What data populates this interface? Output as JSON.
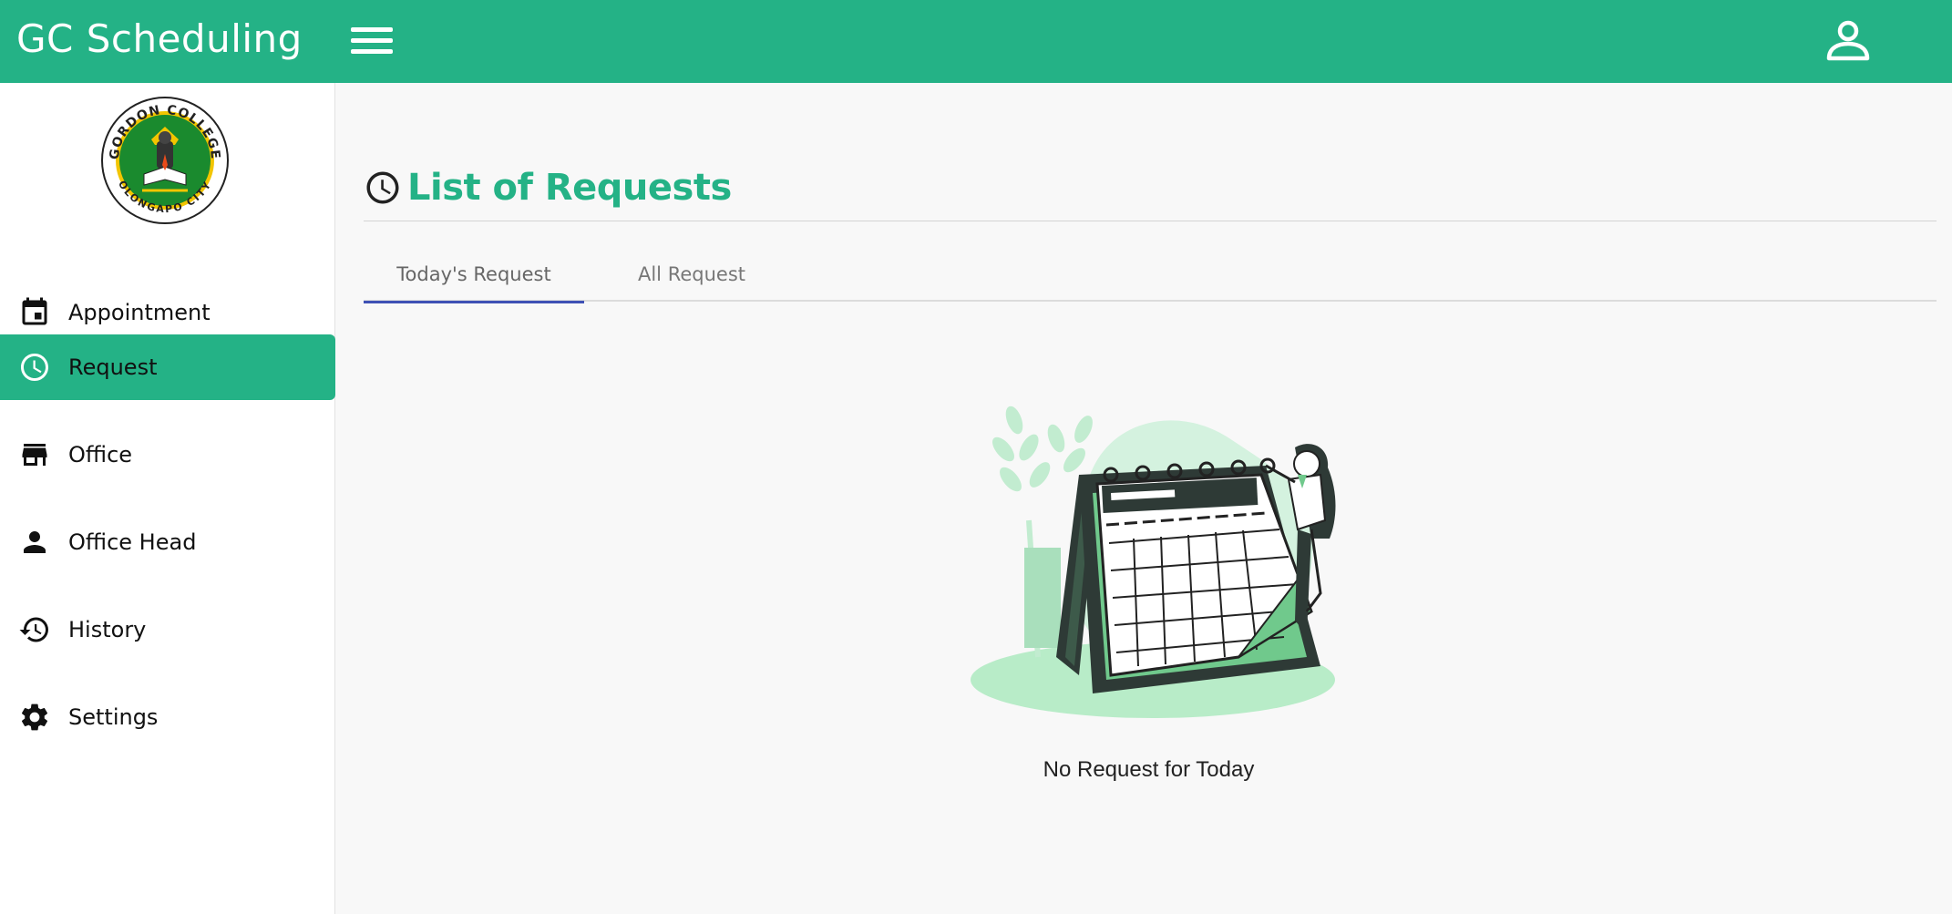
{
  "app": {
    "title": "GC Scheduling"
  },
  "header": {
    "menu_icon": "hamburger-icon",
    "account_icon": "person-outline-icon"
  },
  "sidebar": {
    "logo": {
      "top_text": "GORDON COLLEGE",
      "bottom_text": "OLONGAPO CITY",
      "colors": [
        "#1a8a2e",
        "#f2c500",
        "#222222"
      ]
    },
    "items": [
      {
        "label": "Appointment",
        "icon": "calendar-icon",
        "active": false
      },
      {
        "label": "Request",
        "icon": "clock-icon",
        "active": true
      },
      {
        "label": "Office",
        "icon": "store-icon",
        "active": false
      },
      {
        "label": "Office Head",
        "icon": "person-icon",
        "active": false
      },
      {
        "label": "History",
        "icon": "history-icon",
        "active": false
      },
      {
        "label": "Settings",
        "icon": "gear-icon",
        "active": false
      }
    ]
  },
  "main": {
    "title": "List of Requests",
    "title_icon": "clock-icon",
    "tabs": [
      {
        "label": "Today's Request",
        "active": true
      },
      {
        "label": "All Request",
        "active": false
      }
    ],
    "empty_state": {
      "message": "No Request for Today",
      "illustration": "calendar-illustration"
    }
  },
  "theme": {
    "accent": "#24b286",
    "tab_indicator": "#3f51b5",
    "background": "#f8f8f8"
  }
}
